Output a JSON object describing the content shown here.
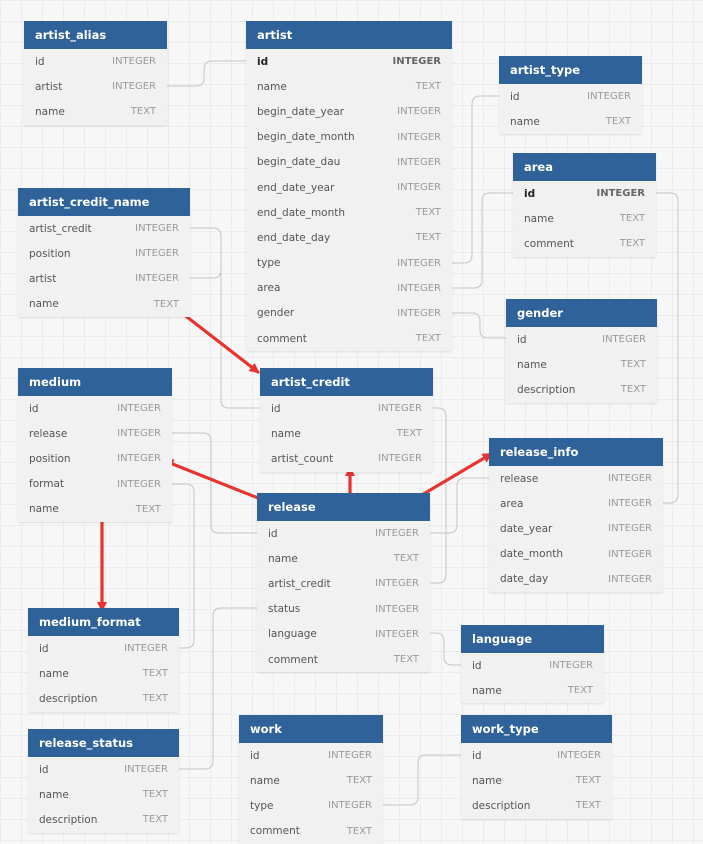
{
  "tables": {
    "artist_alias": {
      "name": "artist_alias",
      "fields": [
        {
          "name": "id",
          "type": "INTEGER"
        },
        {
          "name": "artist",
          "type": "INTEGER"
        },
        {
          "name": "name",
          "type": "TEXT"
        }
      ]
    },
    "artist": {
      "name": "artist",
      "fields": [
        {
          "name": "id",
          "type": "INTEGER",
          "pk": true
        },
        {
          "name": "name",
          "type": "TEXT"
        },
        {
          "name": "begin_date_year",
          "type": "INTEGER"
        },
        {
          "name": "begin_date_month",
          "type": "INTEGER"
        },
        {
          "name": "begin_date_dau",
          "type": "INTEGER"
        },
        {
          "name": "end_date_year",
          "type": "INTEGER"
        },
        {
          "name": "end_date_month",
          "type": "TEXT"
        },
        {
          "name": "end_date_day",
          "type": "TEXT"
        },
        {
          "name": "type",
          "type": "INTEGER"
        },
        {
          "name": "area",
          "type": "INTEGER"
        },
        {
          "name": "gender",
          "type": "INTEGER"
        },
        {
          "name": "comment",
          "type": "TEXT"
        }
      ]
    },
    "artist_type": {
      "name": "artist_type",
      "fields": [
        {
          "name": "id",
          "type": "INTEGER"
        },
        {
          "name": "name",
          "type": "TEXT"
        }
      ]
    },
    "area": {
      "name": "area",
      "fields": [
        {
          "name": "id",
          "type": "INTEGER",
          "pk": true
        },
        {
          "name": "name",
          "type": "TEXT"
        },
        {
          "name": "comment",
          "type": "TEXT"
        }
      ]
    },
    "artist_credit_name": {
      "name": "artist_credit_name",
      "fields": [
        {
          "name": "artist_credit",
          "type": "INTEGER"
        },
        {
          "name": "position",
          "type": "INTEGER"
        },
        {
          "name": "artist",
          "type": "INTEGER"
        },
        {
          "name": "name",
          "type": "TEXT"
        }
      ]
    },
    "gender": {
      "name": "gender",
      "fields": [
        {
          "name": "id",
          "type": "INTEGER"
        },
        {
          "name": "name",
          "type": "TEXT"
        },
        {
          "name": "description",
          "type": "TEXT"
        }
      ]
    },
    "medium": {
      "name": "medium",
      "fields": [
        {
          "name": "id",
          "type": "INTEGER"
        },
        {
          "name": "release",
          "type": "INTEGER"
        },
        {
          "name": "position",
          "type": "INTEGER"
        },
        {
          "name": "format",
          "type": "INTEGER"
        },
        {
          "name": "name",
          "type": "TEXT"
        }
      ]
    },
    "artist_credit": {
      "name": "artist_credit",
      "fields": [
        {
          "name": "id",
          "type": "INTEGER"
        },
        {
          "name": "name",
          "type": "TEXT"
        },
        {
          "name": "artist_count",
          "type": "INTEGER"
        }
      ]
    },
    "release_info": {
      "name": "release_info",
      "fields": [
        {
          "name": "release",
          "type": "INTEGER"
        },
        {
          "name": "area",
          "type": "INTEGER"
        },
        {
          "name": "date_year",
          "type": "INTEGER"
        },
        {
          "name": "date_month",
          "type": "INTEGER"
        },
        {
          "name": "date_day",
          "type": "INTEGER"
        }
      ]
    },
    "release": {
      "name": "release",
      "fields": [
        {
          "name": "id",
          "type": "INTEGER"
        },
        {
          "name": "name",
          "type": "TEXT"
        },
        {
          "name": "artist_credit",
          "type": "INTEGER"
        },
        {
          "name": "status",
          "type": "INTEGER"
        },
        {
          "name": "language",
          "type": "INTEGER"
        },
        {
          "name": "comment",
          "type": "TEXT"
        }
      ]
    },
    "medium_format": {
      "name": "medium_format",
      "fields": [
        {
          "name": "id",
          "type": "INTEGER"
        },
        {
          "name": "name",
          "type": "TEXT"
        },
        {
          "name": "description",
          "type": "TEXT"
        }
      ]
    },
    "language": {
      "name": "language",
      "fields": [
        {
          "name": "id",
          "type": "INTEGER"
        },
        {
          "name": "name",
          "type": "TEXT"
        }
      ]
    },
    "release_status": {
      "name": "release_status",
      "fields": [
        {
          "name": "id",
          "type": "INTEGER"
        },
        {
          "name": "name",
          "type": "TEXT"
        },
        {
          "name": "description",
          "type": "TEXT"
        }
      ]
    },
    "work": {
      "name": "work",
      "fields": [
        {
          "name": "id",
          "type": "INTEGER"
        },
        {
          "name": "name",
          "type": "TEXT"
        },
        {
          "name": "type",
          "type": "INTEGER"
        },
        {
          "name": "comment",
          "type": "TEXT"
        }
      ]
    },
    "work_type": {
      "name": "work_type",
      "fields": [
        {
          "name": "id",
          "type": "INTEGER"
        },
        {
          "name": "name",
          "type": "TEXT"
        },
        {
          "name": "description",
          "type": "TEXT"
        }
      ]
    }
  },
  "colors": {
    "header": "#2f6298",
    "connector": "#c4c4c4",
    "annotation_arrow": "#e8342e"
  }
}
